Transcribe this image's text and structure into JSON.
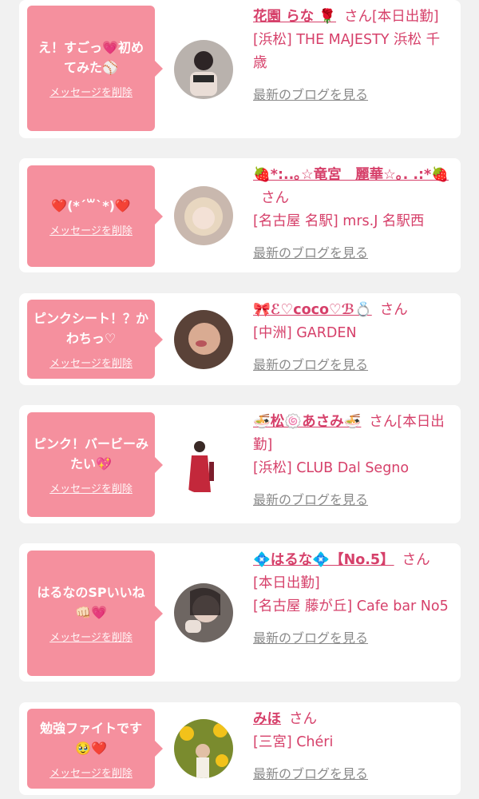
{
  "cards": [
    {
      "message": "え！すごっ💗初めてみた⚾",
      "delete_label": "メッセージを削除",
      "name": "花園 らな 🌹",
      "honorific": "さん",
      "status": "[本日出勤]",
      "shop": "[浜松] THE MAJESTY 浜松 千歳",
      "blog_label": "最新のブログを見る"
    },
    {
      "message": "❤️(*´꒳`*)❤️",
      "delete_label": "メッセージを削除",
      "name": "🍓*:..｡☆竜宮　麗華☆｡. .:*🍓",
      "honorific": "さん",
      "status": "",
      "shop": "[名古屋 名駅] mrs.J 名駅西",
      "blog_label": "最新のブログを見る"
    },
    {
      "message": "ピンクシート！？かわちっ♡",
      "delete_label": "メッセージを削除",
      "name": "🎀ℰ♡coco♡ℬ💍",
      "honorific": "さん",
      "status": "",
      "shop": "[中洲] GARDEN",
      "blog_label": "最新のブログを見る"
    },
    {
      "message": "ピンク！バービーみたい💖",
      "delete_label": "メッセージを削除",
      "name": "🍜松🍥あさみ🍜",
      "honorific": "さん",
      "status": "[本日出勤]",
      "shop": "[浜松] CLUB Dal Segno",
      "blog_label": "最新のブログを見る"
    },
    {
      "message": "はるなのSPいいね👊🏻💗",
      "delete_label": "メッセージを削除",
      "name": "💠はるな💠【No.5】",
      "honorific": "さん",
      "status": "[本日出勤]",
      "shop": "[名古屋 藤が丘] Cafe bar No5",
      "blog_label": "最新のブログを見る"
    },
    {
      "message": "勉強ファイトです🥹❤️",
      "delete_label": "メッセージを削除",
      "name": "みほ",
      "honorific": "さん",
      "status": "",
      "shop": "[三宮] Chéri",
      "blog_label": "最新のブログを見る"
    }
  ],
  "colors": {
    "accent": "#d6406a",
    "bubble": "#f5909e",
    "background": "#f1f1f1",
    "link_gray": "#8a8a8a"
  }
}
